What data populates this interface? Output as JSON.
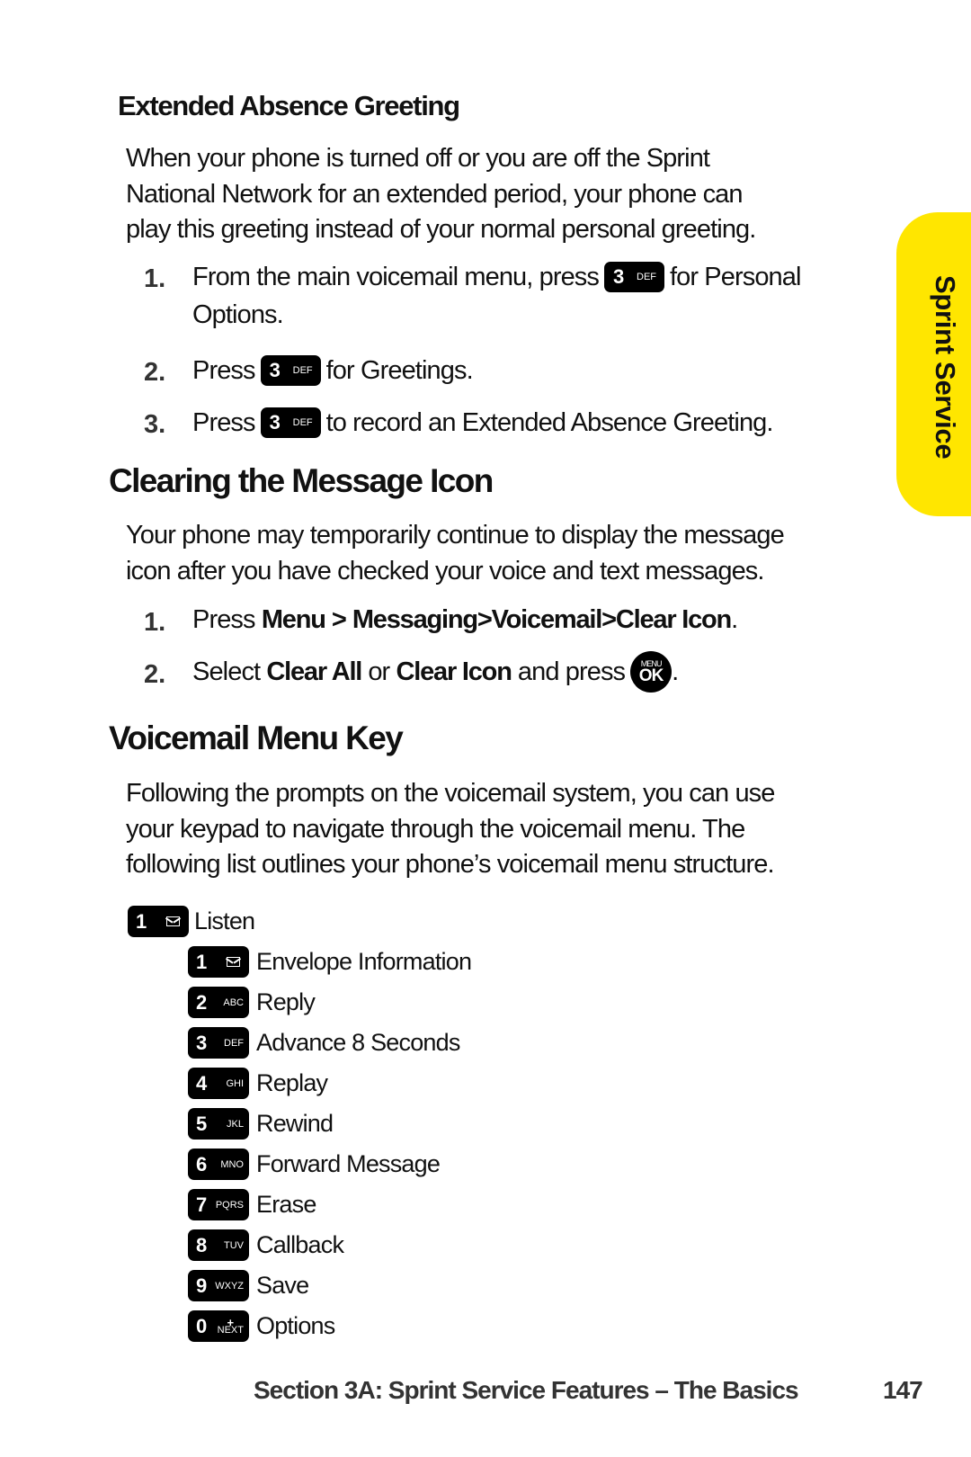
{
  "side_tab": {
    "label": "Sprint Service",
    "color": "#ffe600"
  },
  "extended_absence": {
    "heading": "Extended Absence Greeting",
    "paragraph": [
      "When your phone is turned off or you are off the Sprint",
      "National Network for an extended period, your phone can",
      "play this greeting instead of your normal personal greeting."
    ],
    "steps": [
      {
        "num": "1.",
        "before": "From the main voicemail menu, press",
        "key": {
          "digit": "3",
          "letters": "DEF"
        },
        "after": "for Personal",
        "cont": "Options."
      },
      {
        "num": "2.",
        "before": "Press",
        "key": {
          "digit": "3",
          "letters": "DEF"
        },
        "after": "for Greetings."
      },
      {
        "num": "3.",
        "before": "Press",
        "key": {
          "digit": "3",
          "letters": "DEF"
        },
        "after": "to record an Extended Absence Greeting."
      }
    ]
  },
  "clearing": {
    "heading": "Clearing the Message Icon",
    "paragraph": [
      "Your phone may temporarily continue to display the message",
      "icon after you have checked your voice and text messages."
    ],
    "step1": {
      "num": "1.",
      "press": "Press",
      "path": [
        "Menu",
        "Messaging",
        "Voicemail",
        "Clear Icon"
      ],
      "sep": ">",
      "end": "."
    },
    "step2": {
      "num": "2.",
      "select": "Select",
      "opt1": "Clear All",
      "or": "or",
      "opt2": "Clear Icon",
      "and_press": "and press",
      "button_top": "MENU",
      "button_main": "OK",
      "end": "."
    }
  },
  "menu_key": {
    "heading": "Voicemail Menu Key",
    "paragraph": [
      "Following the prompts on the voicemail system, you can use",
      "your keypad to navigate through the voicemail menu. The",
      "following list outlines your phone’s voicemail menu structure."
    ],
    "top": {
      "digit": "1",
      "icon": "envelope-icon",
      "label": "Listen"
    },
    "items": [
      {
        "digit": "1",
        "letters": "",
        "icon": "envelope-icon",
        "label": "Envelope Information"
      },
      {
        "digit": "2",
        "letters": "ABC",
        "label": "Reply"
      },
      {
        "digit": "3",
        "letters": "DEF",
        "label": "Advance 8 Seconds"
      },
      {
        "digit": "4",
        "letters": "GHI",
        "label": "Replay"
      },
      {
        "digit": "5",
        "letters": "JKL",
        "label": "Rewind"
      },
      {
        "digit": "6",
        "letters": "MNO",
        "label": "Forward Message"
      },
      {
        "digit": "7",
        "letters": "PQRS",
        "label": "Erase"
      },
      {
        "digit": "8",
        "letters": "TUV",
        "label": "Callback"
      },
      {
        "digit": "9",
        "letters": "WXYZ",
        "label": "Save"
      },
      {
        "digit": "0",
        "letters": "NEXT",
        "plus": "+",
        "label": "Options"
      }
    ]
  },
  "footer": {
    "section": "Section 3A: Sprint Service Features – The Basics",
    "page": "147"
  }
}
